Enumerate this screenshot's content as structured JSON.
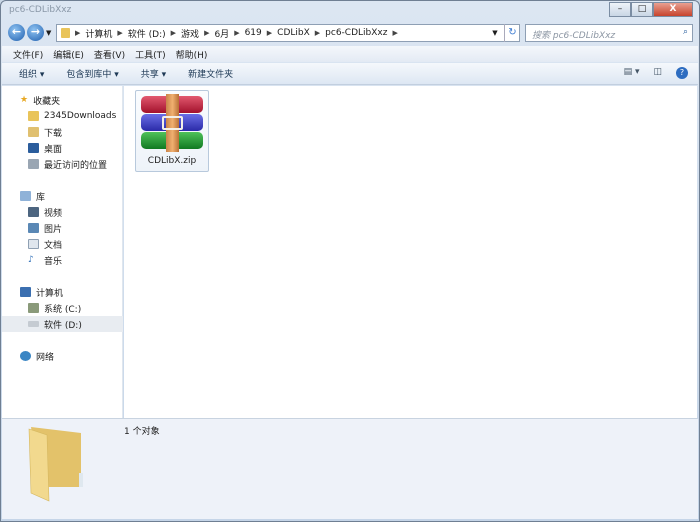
{
  "window": {
    "title": "pc6-CDLibXxz",
    "min": "–",
    "max": "□",
    "close": "X"
  },
  "nav": {
    "back": "←",
    "forward": "→"
  },
  "address": {
    "crumbs": [
      "计算机",
      "软件 (D:)",
      "游戏",
      "6月",
      "619",
      "CDLibX",
      "pc6-CDLibXxz"
    ]
  },
  "search": {
    "placeholder": "搜索 pc6-CDLibXxz"
  },
  "menu": [
    "文件(F)",
    "编辑(E)",
    "查看(V)",
    "工具(T)",
    "帮助(H)"
  ],
  "toolbar": {
    "organize": "组织 ▾",
    "include": "包含到库中 ▾",
    "share": "共享 ▾",
    "new_folder": "新建文件夹"
  },
  "sidebar": {
    "favorites": "收藏夹",
    "fav_items": [
      "2345Downloads",
      "下载",
      "桌面",
      "最近访问的位置"
    ],
    "libraries": "库",
    "lib_items": [
      "视频",
      "图片",
      "文档",
      "音乐"
    ],
    "computer": "计算机",
    "drives": [
      "系统 (C:)",
      "软件 (D:)"
    ],
    "network": "网络"
  },
  "files": [
    {
      "name": "CDLibX.zip"
    }
  ],
  "details": {
    "count": "1 个对象"
  }
}
